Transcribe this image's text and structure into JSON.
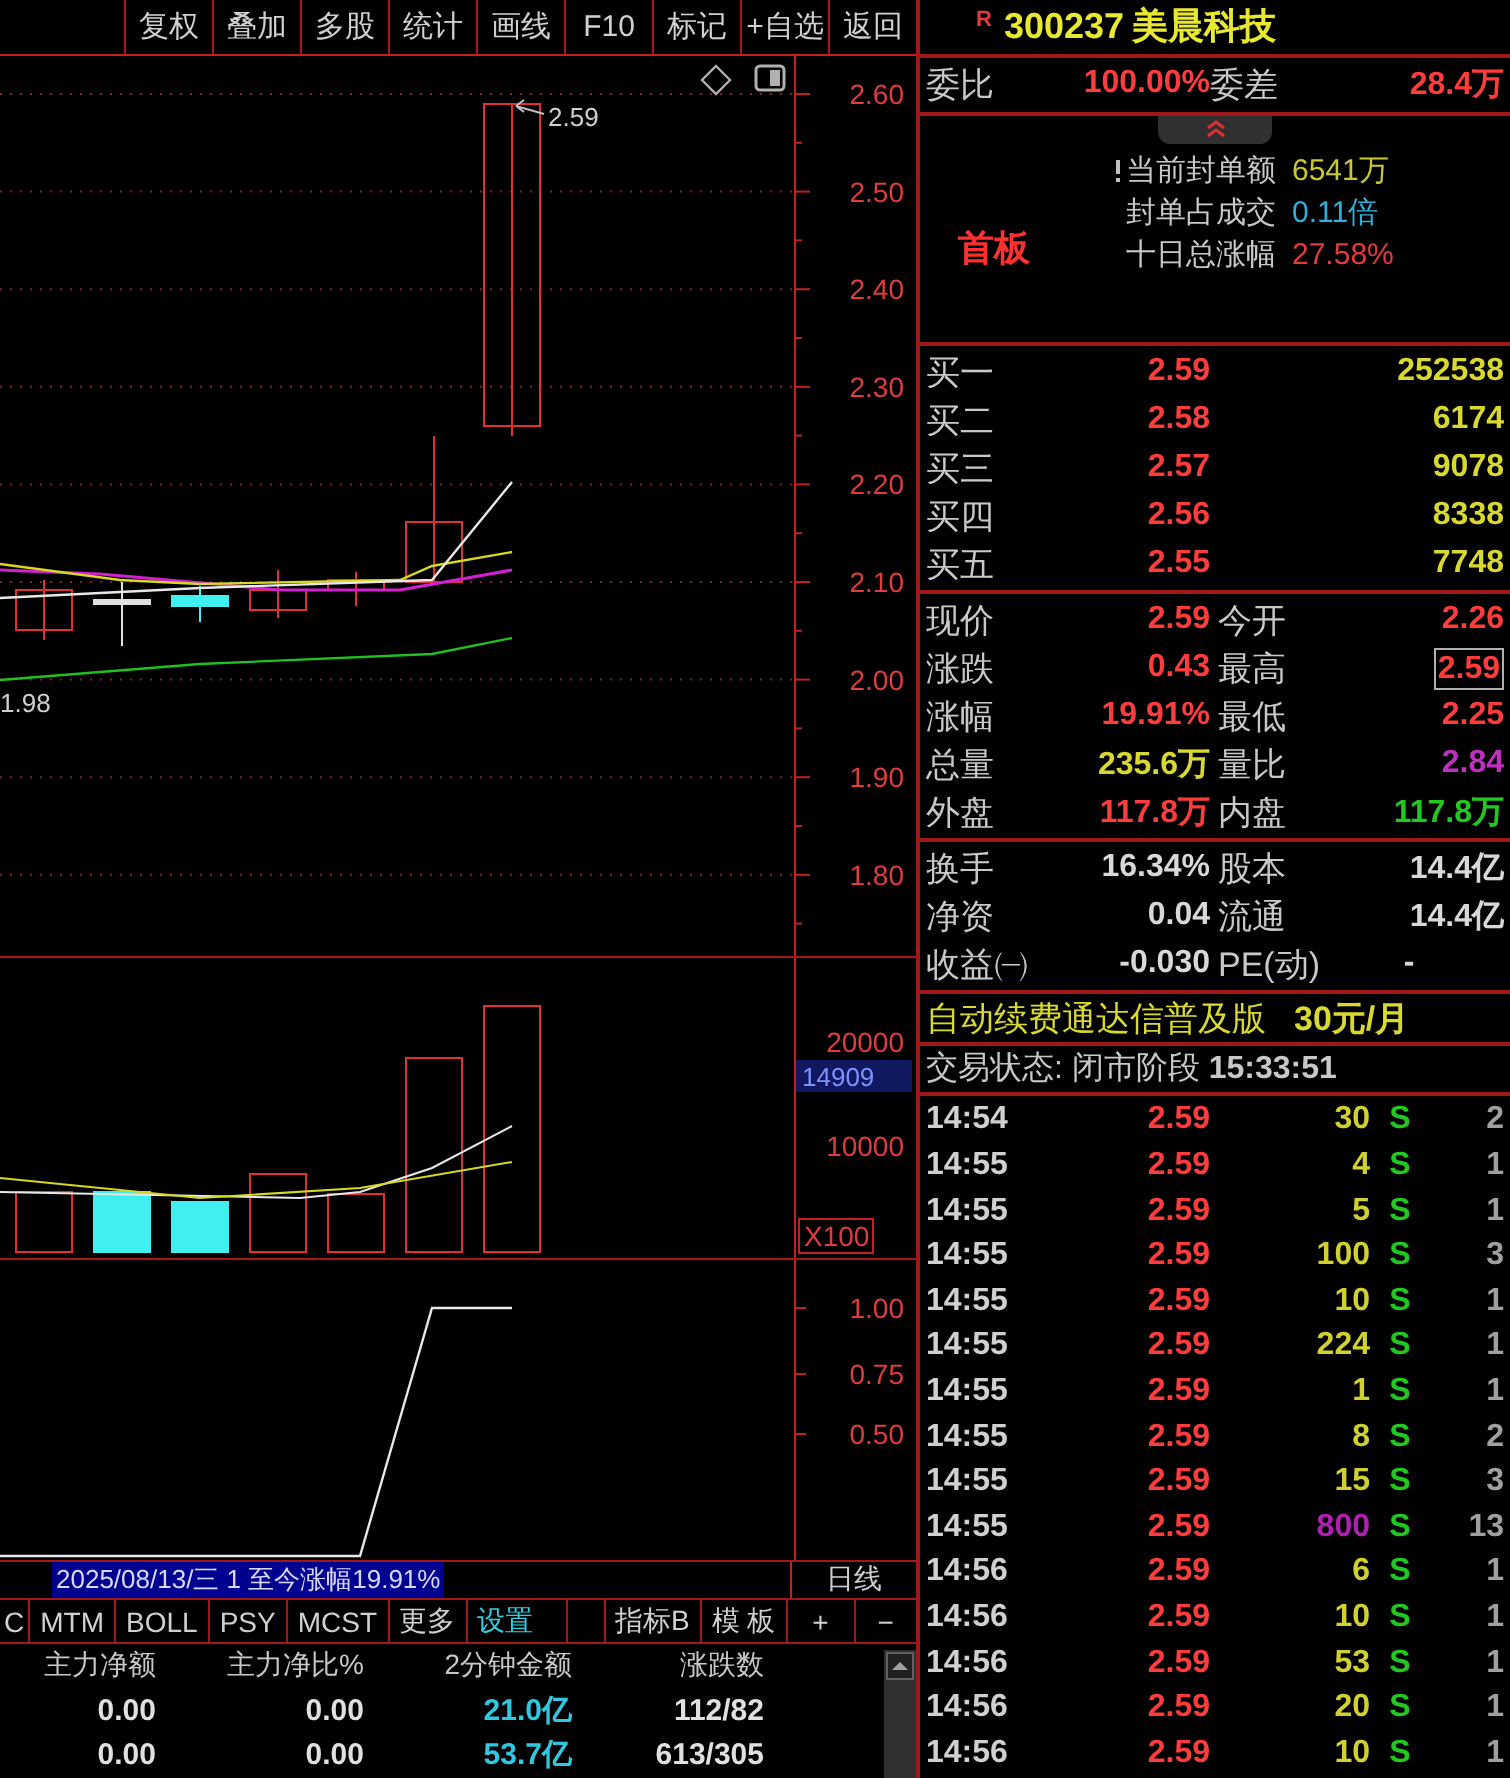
{
  "toolbar": [
    "复权",
    "叠加",
    "多股",
    "统计",
    "画线",
    "F10",
    "标记",
    "+自选",
    "返回"
  ],
  "price_chart": {
    "axis": [
      "2.60",
      "2.50",
      "2.40",
      "2.30",
      "2.20",
      "2.10",
      "2.00",
      "1.90",
      "1.80"
    ],
    "last_price_label": "2.59",
    "low_label": "1.98"
  },
  "volume_chart": {
    "axis": [
      {
        "label": "20000",
        "kind": "tick"
      },
      {
        "label": "14909",
        "kind": "current"
      },
      {
        "label": "10000",
        "kind": "tick"
      },
      {
        "label": "X100",
        "kind": "unit"
      }
    ]
  },
  "indicator_chart": {
    "axis": [
      "1.00",
      "0.75",
      "0.50"
    ]
  },
  "date_bar": {
    "text": "2025/08/13/三 1 至今涨幅19.91%",
    "period": "日线"
  },
  "indicator_tabs": [
    {
      "label": "C",
      "highlighted": false
    },
    {
      "label": "MTM",
      "highlighted": false
    },
    {
      "label": "BOLL",
      "highlighted": false
    },
    {
      "label": "PSY",
      "highlighted": false
    },
    {
      "label": "MCST",
      "highlighted": false
    },
    {
      "label": "更多",
      "highlighted": false
    },
    {
      "label": "设置",
      "highlighted": true
    },
    {
      "label": "指标B",
      "highlighted": false
    },
    {
      "label": "模 板",
      "highlighted": false
    },
    {
      "label": "+",
      "highlighted": false
    },
    {
      "label": "−",
      "highlighted": false
    }
  ],
  "money_flow": {
    "columns": [
      "主力净额",
      "主力净比%",
      "2分钟金额",
      "涨跌数"
    ],
    "rows": [
      [
        "0.00",
        "0.00",
        "21.0亿",
        "112/82"
      ],
      [
        "0.00",
        "0.00",
        "53.7亿",
        "613/305"
      ]
    ]
  },
  "stock": {
    "flag": "R",
    "code": "300237",
    "name": "美晨科技"
  },
  "commission": [
    {
      "label": "委比",
      "value": "100.00%"
    },
    {
      "label": "委差",
      "value": "28.4万"
    }
  ],
  "seal": {
    "tag": "首板",
    "items": [
      {
        "label": "当前封单额",
        "value": "6541万",
        "color": "#c8c830"
      },
      {
        "label": "封单占成交",
        "value": "0.11倍",
        "color": "#30b0d8"
      },
      {
        "label": "十日总涨幅",
        "value": "27.58%",
        "color": "#e03c3c"
      }
    ]
  },
  "order_book": [
    {
      "label": "买一",
      "price": "2.59",
      "volume": "252538"
    },
    {
      "label": "买二",
      "price": "2.58",
      "volume": "6174"
    },
    {
      "label": "买三",
      "price": "2.57",
      "volume": "9078"
    },
    {
      "label": "买四",
      "price": "2.56",
      "volume": "8338"
    },
    {
      "label": "买五",
      "price": "2.55",
      "volume": "7748"
    }
  ],
  "quote": [
    {
      "label": "现价",
      "value": "2.59",
      "color": "#ff3c3c",
      "highlighted": false
    },
    {
      "label": "今开",
      "value": "2.26",
      "color": "#ff3c3c",
      "highlighted": false
    },
    {
      "label": "涨跌",
      "value": "0.43",
      "color": "#ff3c3c",
      "highlighted": false
    },
    {
      "label": "最高",
      "value": "2.59",
      "color": "#ff3c3c",
      "highlighted": true
    },
    {
      "label": "涨幅",
      "value": "19.91%",
      "color": "#ff3c3c",
      "highlighted": false
    },
    {
      "label": "最低",
      "value": "2.25",
      "color": "#ff3c3c",
      "highlighted": false
    },
    {
      "label": "总量",
      "value": "235.6万",
      "color": "#d8d830",
      "highlighted": false
    },
    {
      "label": "量比",
      "value": "2.84",
      "color": "#c030c0",
      "highlighted": false
    },
    {
      "label": "外盘",
      "value": "117.8万",
      "color": "#ff3c3c",
      "highlighted": false
    },
    {
      "label": "内盘",
      "value": "117.8万",
      "color": "#20c820",
      "highlighted": false
    }
  ],
  "fundamentals": [
    {
      "label": "换手",
      "value": "16.34%"
    },
    {
      "label": "股本",
      "value": "14.4亿"
    },
    {
      "label": "净资",
      "value": "0.04"
    },
    {
      "label": "流通",
      "value": "14.4亿"
    },
    {
      "label": "收益㈠",
      "value": "-0.030"
    },
    {
      "label": "PE(动)",
      "value": "-"
    }
  ],
  "ad": {
    "text": "自动续费通达信普及版",
    "price": "30元/月"
  },
  "status": "交易状态: 闭市阶段 **15:33:51**",
  "ticks": [
    {
      "time": "14:54",
      "price": "2.59",
      "volume": "30",
      "color": "#d0d030",
      "side": "S",
      "count": "2"
    },
    {
      "time": "14:55",
      "price": "2.59",
      "volume": "4",
      "color": "#d0d030",
      "side": "S",
      "count": "1"
    },
    {
      "time": "14:55",
      "price": "2.59",
      "volume": "5",
      "color": "#d0d030",
      "side": "S",
      "count": "1"
    },
    {
      "time": "14:55",
      "price": "2.59",
      "volume": "100",
      "color": "#d0d030",
      "side": "S",
      "count": "3"
    },
    {
      "time": "14:55",
      "price": "2.59",
      "volume": "10",
      "color": "#d0d030",
      "side": "S",
      "count": "1"
    },
    {
      "time": "14:55",
      "price": "2.59",
      "volume": "224",
      "color": "#d0d030",
      "side": "S",
      "count": "1"
    },
    {
      "time": "14:55",
      "price": "2.59",
      "volume": "1",
      "color": "#d0d030",
      "side": "S",
      "count": "1"
    },
    {
      "time": "14:55",
      "price": "2.59",
      "volume": "8",
      "color": "#d0d030",
      "side": "S",
      "count": "2"
    },
    {
      "time": "14:55",
      "price": "2.59",
      "volume": "15",
      "color": "#d0d030",
      "side": "S",
      "count": "3"
    },
    {
      "time": "14:55",
      "price": "2.59",
      "volume": "800",
      "color": "#b020b0",
      "side": "S",
      "count": "13"
    },
    {
      "time": "14:56",
      "price": "2.59",
      "volume": "6",
      "color": "#d0d030",
      "side": "S",
      "count": "1"
    },
    {
      "time": "14:56",
      "price": "2.59",
      "volume": "10",
      "color": "#d0d030",
      "side": "S",
      "count": "1"
    },
    {
      "time": "14:56",
      "price": "2.59",
      "volume": "53",
      "color": "#d0d030",
      "side": "S",
      "count": "1"
    },
    {
      "time": "14:56",
      "price": "2.59",
      "volume": "20",
      "color": "#d0d030",
      "side": "S",
      "count": "1"
    },
    {
      "time": "14:56",
      "price": "2.59",
      "volume": "10",
      "color": "#d0d030",
      "side": "S",
      "count": "1"
    }
  ]
}
